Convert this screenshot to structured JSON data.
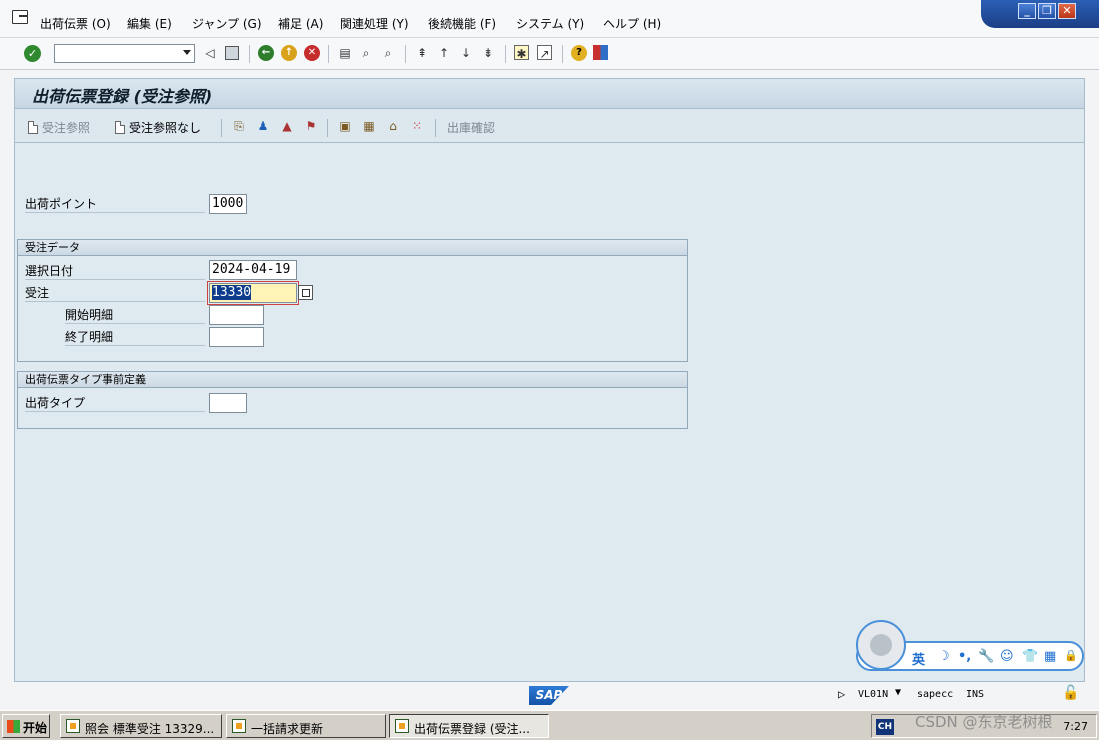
{
  "menubar": {
    "items": [
      "出荷伝票 (O)",
      "編集 (E)",
      "ジャンプ (G)",
      "補足 (A)",
      "関連処理 (Y)",
      "後続機能 (F)",
      "システム (Y)",
      "ヘルプ (H)"
    ]
  },
  "window_controls": {
    "minimize": "_",
    "restore": "❐",
    "close": "✕"
  },
  "toolbar": {
    "command_field_value": "",
    "icons": [
      "enter-icon",
      "back-arrow-icon",
      "save-icon",
      "back-icon",
      "exit-icon",
      "cancel-icon",
      "print-icon",
      "find-icon",
      "find-next-icon",
      "first-page-icon",
      "previous-page-icon",
      "next-page-icon",
      "last-page-icon",
      "new-session-icon",
      "shortcut-icon",
      "help-icon",
      "layout-icon"
    ]
  },
  "title": "出荷伝票登録 (受注参照)",
  "app_toolbar": {
    "order_reference": "受注参照",
    "without_order_reference": "受注参照なし",
    "goods_issue": "出庫確認"
  },
  "form": {
    "shipping_point_label": "出荷ポイント",
    "shipping_point_value": "1000",
    "order_data_group": "受注データ",
    "selection_date_label": "選択日付",
    "selection_date_value": "2024-04-19",
    "order_label": "受注",
    "order_value": "13330",
    "from_item_label": "開始明細",
    "from_item_value": "",
    "to_item_label": "終了明細",
    "to_item_value": "",
    "delivery_type_group": "出荷伝票タイプ事前定義",
    "delivery_type_label": "出荷タイプ",
    "delivery_type_value": ""
  },
  "ime": {
    "mode": "英",
    "items": [
      "☽",
      "•,",
      "🔧",
      "☺",
      "👕",
      "▦",
      "🔒"
    ]
  },
  "statusbar": {
    "logo": "SAP",
    "transaction": "VL01N",
    "system": "sapecc",
    "insert_mode": "INS"
  },
  "taskbar": {
    "start": "开始",
    "tasks": [
      "照会 標準受注 13329...",
      "一括請求更新",
      "出荷伝票登録 (受注..."
    ],
    "lang": "CH",
    "clock": "7:27"
  },
  "watermark": "CSDN @东京老树根"
}
